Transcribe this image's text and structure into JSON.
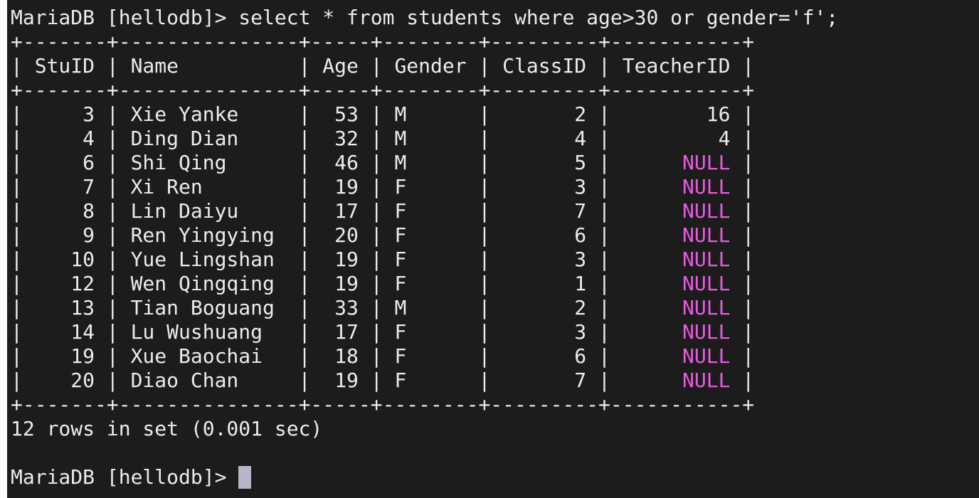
{
  "terminal": {
    "prompt": "MariaDB [hellodb]> ",
    "command": "select * from students where age>30 or gender='f';",
    "separator": "+-------+---------------+-----+--------+---------+-----------+",
    "header_line": "| StuID | Name          | Age | Gender | ClassID | TeacherID |",
    "rows": [
      {
        "pre": "|     3 | Xie Yanke     |  53 | M      |       2 | ",
        "teacher": "       16",
        "post": " |"
      },
      {
        "pre": "|     4 | Ding Dian     |  32 | M      |       4 | ",
        "teacher": "        4",
        "post": " |"
      },
      {
        "pre": "|     6 | Shi Qing      |  46 | M      |       5 | ",
        "teacher": "     NULL",
        "post": " |"
      },
      {
        "pre": "|     7 | Xi Ren        |  19 | F      |       3 | ",
        "teacher": "     NULL",
        "post": " |"
      },
      {
        "pre": "|     8 | Lin Daiyu     |  17 | F      |       7 | ",
        "teacher": "     NULL",
        "post": " |"
      },
      {
        "pre": "|     9 | Ren Yingying  |  20 | F      |       6 | ",
        "teacher": "     NULL",
        "post": " |"
      },
      {
        "pre": "|    10 | Yue Lingshan  |  19 | F      |       3 | ",
        "teacher": "     NULL",
        "post": " |"
      },
      {
        "pre": "|    12 | Wen Qingqing  |  19 | F      |       1 | ",
        "teacher": "     NULL",
        "post": " |"
      },
      {
        "pre": "|    13 | Tian Boguang  |  33 | M      |       2 | ",
        "teacher": "     NULL",
        "post": " |"
      },
      {
        "pre": "|    14 | Lu Wushuang   |  17 | F      |       3 | ",
        "teacher": "     NULL",
        "post": " |"
      },
      {
        "pre": "|    19 | Xue Baochai   |  18 | F      |       6 | ",
        "teacher": "     NULL",
        "post": " |"
      },
      {
        "pre": "|    20 | Diao Chan     |  19 | F      |       7 | ",
        "teacher": "     NULL",
        "post": " |"
      }
    ],
    "result_summary": "12 rows in set (0.001 sec)",
    "final_prompt": "MariaDB [hellodb]> "
  },
  "colors": {
    "background": "#1c1c1c",
    "text": "#ececec",
    "null_value": "#e85ae0",
    "cursor": "#b6b6c8"
  }
}
